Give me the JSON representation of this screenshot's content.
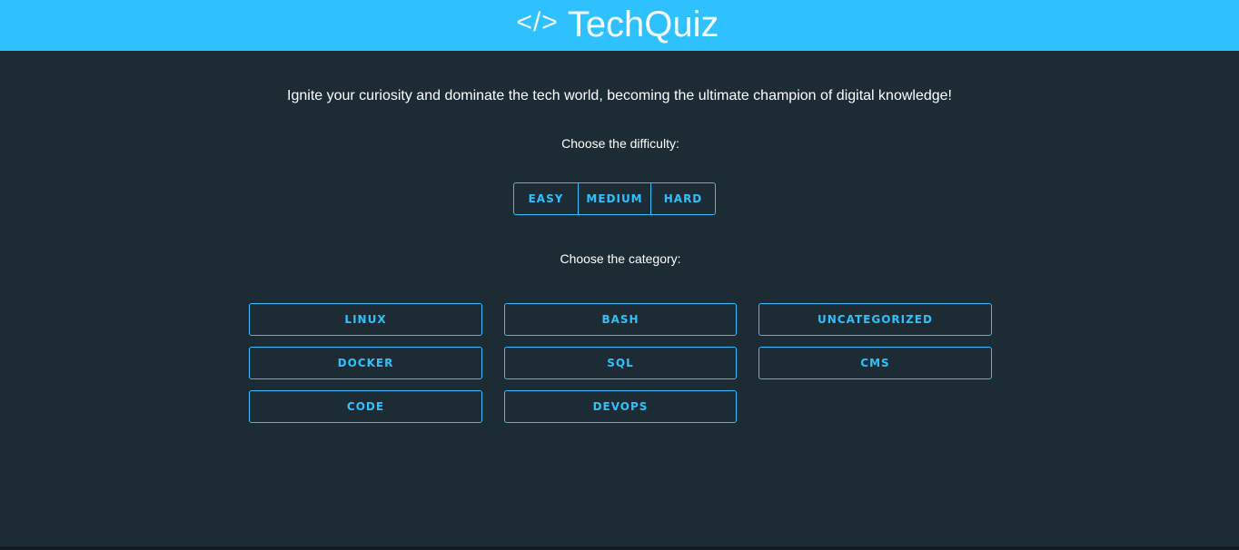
{
  "header": {
    "icon": "code-icon",
    "icon_glyph": "</>",
    "title": "TechQuiz"
  },
  "intro": {
    "tagline": "Ignite your curiosity and dominate the tech world, becoming the ultimate champion of digital knowledge!"
  },
  "difficulty": {
    "label": "Choose the difficulty:",
    "options": [
      "EASY",
      "MEDIUM",
      "HARD"
    ]
  },
  "category": {
    "label": "Choose the category:",
    "options": [
      "LINUX",
      "BASH",
      "UNCATEGORIZED",
      "DOCKER",
      "SQL",
      "CMS",
      "CODE",
      "DEVOPS"
    ]
  },
  "colors": {
    "accent": "#2ec1fd",
    "background": "#1c2b34",
    "text": "#ffffff"
  }
}
